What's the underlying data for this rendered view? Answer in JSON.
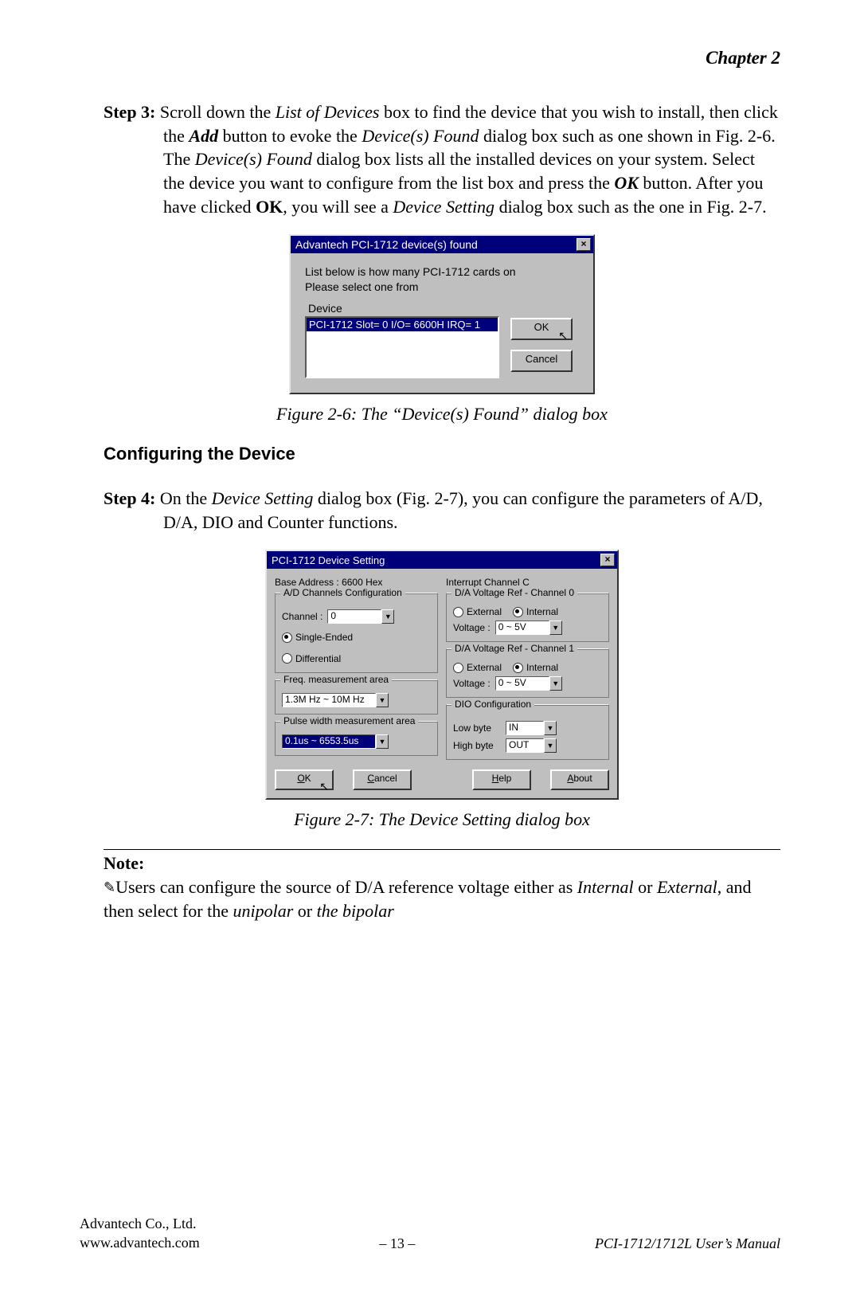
{
  "header": {
    "chapter": "Chapter 2"
  },
  "step3": {
    "label": "Step 3:",
    "t1": " Scroll down the ",
    "i1": "List of Devices",
    "t2": " box to find the device that you wish to install, then click the ",
    "b1": "Add",
    "t3": " button to evoke the ",
    "i2": "Device(s) Found",
    "t4": " dialog box such as one shown in Fig. 2-6. The ",
    "i3": "Device(s) Found",
    "t5": " dialog box lists all the installed devices on your system. Select the device you want to configure from the list box and press the ",
    "b2": "OK",
    "t6": " button. After you have clicked ",
    "b3": "OK",
    "t7": ", you will see a ",
    "i4": "Device Setting",
    "t8": " dialog box such as the one in Fig. 2-7."
  },
  "dlg1": {
    "title": "Advantech PCI-1712 device(s) found",
    "msg1": "List below is how many PCI-1712 cards on",
    "msg2": "Please select one from",
    "device_label": "Device",
    "list_item": "PCI-1712 Slot= 0   I/O= 6600H   IRQ= 1",
    "ok": "OK",
    "cancel": "Cancel"
  },
  "caption1": "Figure 2-6: The “Device(s) Found” dialog box",
  "subheading": "Configuring the Device",
  "step4": {
    "label": "Step 4:",
    "t1": " On the ",
    "i1": "Device Setting",
    "t2": " dialog box (Fig. 2-7), you can configure the parameters of A/D, D/A, DIO and Counter functions."
  },
  "dlg2": {
    "title": "PCI-1712 Device Setting",
    "base_addr_label": "Base Address :",
    "base_addr_value": "6600  Hex",
    "int_channel_label": "Interrupt Channel",
    "int_channel_value": "C",
    "grp_ad": "A/D Channels Configuration",
    "channel_label": "Channel :",
    "channel_value": "0",
    "single_ended": "Single-Ended",
    "differential": "Differential",
    "grp_da0": "D/A Voltage Ref - Channel 0",
    "external": "External",
    "internal": "Internal",
    "voltage_label": "Voltage :",
    "voltage_value": "0 ~ 5V",
    "grp_da1": "D/A Voltage Ref - Channel 1",
    "grp_freq": "Freq. measurement area",
    "freq_value": "1.3M Hz ~ 10M Hz",
    "grp_dio": "DIO Configuration",
    "low_byte_label": "Low byte",
    "low_byte_value": "IN",
    "high_byte_label": "High byte",
    "high_byte_value": "OUT",
    "grp_pulse": "Pulse width measurement area",
    "pulse_value": "0.1us ~ 6553.5us",
    "btn_ok": "OK",
    "btn_cancel": "Cancel",
    "btn_help": "Help",
    "btn_about": "About"
  },
  "caption2": "Figure 2-7: The Device Setting dialog box",
  "note": {
    "label": "Note:",
    "t1": "Users can configure the source of D/A reference voltage either as ",
    "i1": "Internal",
    "t2": " or ",
    "i2": "External",
    "t3": ", and then select for the ",
    "i3": "unipolar",
    "t4": " or ",
    "i4": "the bipolar"
  },
  "footer": {
    "company": "Advantech Co., Ltd.",
    "url": "www.advantech.com",
    "page": "– 13 –",
    "manual": "PCI-1712/1712L User’s Manual"
  }
}
